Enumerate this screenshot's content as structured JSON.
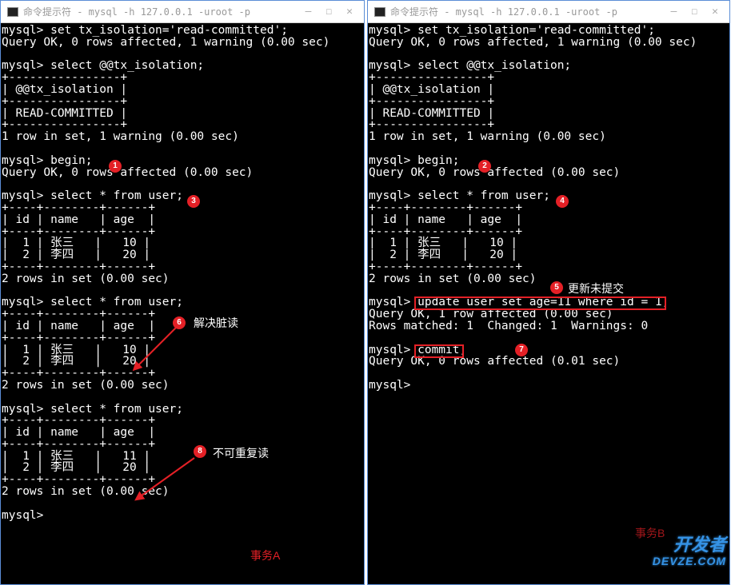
{
  "left": {
    "title": "命令提示符 - mysql  -h 127.0.0.1 -uroot -p",
    "lines": [
      "mysql> set tx_isolation='read-committed';",
      "Query OK, 0 rows affected, 1 warning (0.00 sec)",
      "",
      "mysql> select @@tx_isolation;",
      "+----------------+",
      "| @@tx_isolation |",
      "+----------------+",
      "| READ-COMMITTED |",
      "+----------------+",
      "1 row in set, 1 warning (0.00 sec)",
      "",
      "mysql> begin;",
      "Query OK, 0 rows affected (0.00 sec)",
      "",
      "mysql> select * from user;",
      "+----+--------+------+",
      "| id | name   | age  |",
      "+----+--------+------+",
      "|  1 | 张三   |   10 |",
      "|  2 | 李四   |   20 |",
      "+----+--------+------+",
      "2 rows in set (0.00 sec)",
      "",
      "mysql> select * from user;",
      "+----+--------+------+",
      "| id | name   | age  |",
      "+----+--------+------+",
      "|  1 | 张三   |   10 |",
      "|  2 | 李四   |   20 |",
      "+----+--------+------+",
      "2 rows in set (0.00 sec)",
      "",
      "mysql> select * from user;",
      "+----+--------+------+",
      "| id | name   | age  |",
      "+----+--------+------+",
      "|  1 | 张三   |   11 |",
      "|  2 | 李四   |   20 |",
      "+----+--------+------+",
      "2 rows in set (0.00 sec)",
      "",
      "mysql>"
    ],
    "markers": {
      "m1": "1",
      "m3": "3",
      "m6": "6",
      "m8": "8"
    },
    "anno6": "解决脏读",
    "anno8": "不可重复读",
    "footer_label": "事务A"
  },
  "right": {
    "title": "命令提示符 - mysql  -h 127.0.0.1 -uroot -p",
    "lines": [
      "mysql> set tx_isolation='read-committed';",
      "Query OK, 0 rows affected, 1 warning (0.00 sec)",
      "",
      "mysql> select @@tx_isolation;",
      "+----------------+",
      "| @@tx_isolation |",
      "+----------------+",
      "| READ-COMMITTED |",
      "+----------------+",
      "1 row in set, 1 warning (0.00 sec)",
      "",
      "mysql> begin;",
      "Query OK, 0 rows affected (0.00 sec)",
      "",
      "mysql> select * from user;",
      "+----+--------+------+",
      "| id | name   | age  |",
      "+----+--------+------+",
      "|  1 | 张三   |   10 |",
      "|  2 | 李四   |   20 |",
      "+----+--------+------+",
      "2 rows in set (0.00 sec)",
      "",
      "mysql> update user set age=11 where id = 1;",
      "Query OK, 1 row affected (0.00 sec)",
      "Rows matched: 1  Changed: 1  Warnings: 0",
      "",
      "mysql> commit;",
      "Query OK, 0 rows affected (0.01 sec)",
      "",
      "mysql>"
    ],
    "markers": {
      "m2": "2",
      "m4": "4",
      "m5": "5",
      "m7": "7"
    },
    "anno5": "更新未提交",
    "footer_label": "事务B"
  },
  "buttons": {
    "min": "—",
    "max": "☐",
    "close": "✕"
  },
  "watermark": {
    "top": "开发者",
    "bottom": "DEVZE.COM"
  }
}
